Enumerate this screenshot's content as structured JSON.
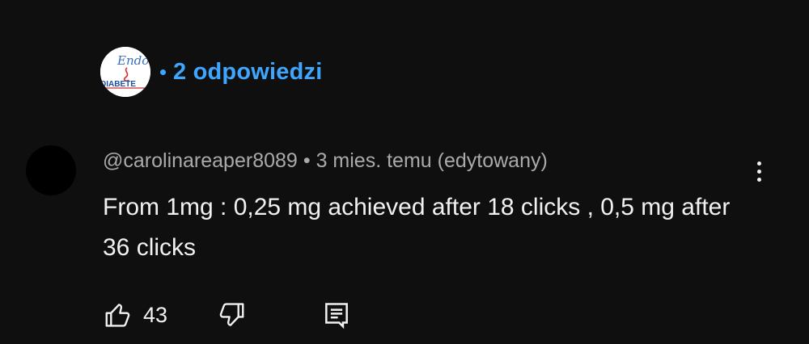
{
  "replies": {
    "avatar_text_line1": "Endo",
    "avatar_text_line2": "DIABETE",
    "label": "2 odpowiedzi"
  },
  "comment": {
    "author": "@carolinareaper8089",
    "separator": "•",
    "time": "3 mies. temu",
    "edited": "(edytowany)",
    "text": "From 1mg : 0,25 mg achieved after 18 clicks , 0,5 mg after 36 clicks"
  },
  "actions": {
    "like_icon": "thumbs-up-icon",
    "like_count": "43",
    "dislike_icon": "thumbs-down-icon",
    "reply_icon": "reply-comment-icon",
    "menu_icon": "more-vertical-icon"
  },
  "colors": {
    "background": "#0f0f0f",
    "link_blue": "#3ea6ff",
    "secondary_text": "#aaaaaa",
    "primary_text": "#f1f1f1"
  }
}
